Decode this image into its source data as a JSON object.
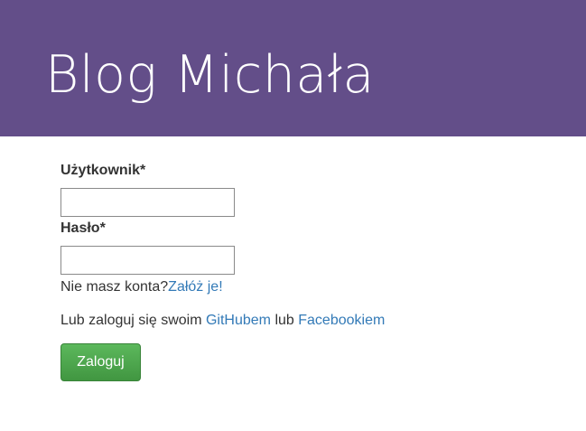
{
  "header": {
    "title": "Blog Michała"
  },
  "login_form": {
    "username_label": "Użytkownik*",
    "username_value": "",
    "password_label": "Hasło*",
    "password_value": "",
    "no_account_text": "Nie masz konta?",
    "register_link": "Załóż je!",
    "social_prefix": "Lub zaloguj się swoim ",
    "github_link": "GitHubem",
    "social_middle": " lub ",
    "facebook_link": "Facebookiem",
    "submit_label": "Zaloguj"
  },
  "colors": {
    "header_bg": "#634e89",
    "link": "#337ab7",
    "button": "#4cae4c"
  }
}
